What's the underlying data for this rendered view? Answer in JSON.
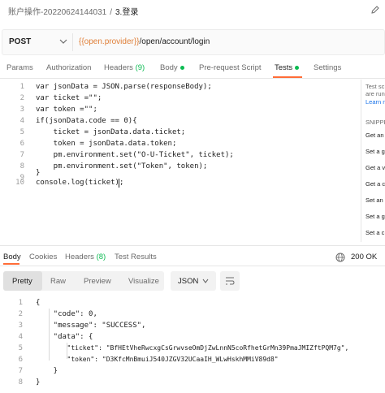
{
  "breadcrumb": {
    "parent": "账户操作-20220624144031",
    "separator": "/",
    "current": "3.登录"
  },
  "request": {
    "method": "POST",
    "url_variable": "{{open.provider}}",
    "url_path": "/open/account/login"
  },
  "request_tabs": {
    "params": "Params",
    "authorization": "Authorization",
    "headers": "Headers",
    "headers_count": "(9)",
    "body": "Body",
    "pre_request": "Pre-request Script",
    "tests": "Tests",
    "settings": "Settings"
  },
  "editor": {
    "line_numbers": [
      "1",
      "2",
      "3",
      "4",
      "5",
      "6",
      "7",
      "8",
      "9",
      "10"
    ],
    "lines": [
      "var jsonData = JSON.parse(responseBody);",
      "var ticket =\"\";",
      "var token =\"\";",
      "if(jsonData.code == 0){",
      "    ticket = jsonData.data.ticket;",
      "    token = jsonData.data.token;",
      "    pm.environment.set(\"O-U-Ticket\", ticket);",
      "    pm.environment.set(\"Token\", token);",
      "}",
      "console.log(ticket);"
    ]
  },
  "snippets_panel": {
    "intro_line1": "Test sc",
    "intro_line2": "are run",
    "learn_more": "Learn m",
    "heading": "SNIPPE",
    "items": [
      "Get an",
      "Set a g",
      "Get a v",
      "Get a c",
      "Set an",
      "Set a g",
      "Set a c"
    ]
  },
  "response_tabs": {
    "body": "Body",
    "cookies": "Cookies",
    "headers": "Headers",
    "headers_count": "(8)",
    "test_results": "Test Results"
  },
  "status": {
    "text": "200 OK",
    "color": "#0cbb52"
  },
  "view_modes": {
    "pretty": "Pretty",
    "raw": "Raw",
    "preview": "Preview",
    "visualize": "Visualize"
  },
  "format": "JSON",
  "response": {
    "line_numbers": [
      "1",
      "2",
      "3",
      "4",
      "5",
      "6",
      "7",
      "8"
    ],
    "lines": [
      "{",
      "    \"code\": 0,",
      "    \"message\": \"SUCCESS\",",
      "    \"data\": {",
      "        \"ticket\": \"BfHEtVheRwcxgCsGrwvseOmDjZwLnnN5coRfhetGrMn39PmaJMIZftPQM7g\",",
      "        \"token\": \"D3KfcMnBmuiJ540JZGV32UCaaIH_WLwHskhMMiV89d8\"",
      "    }",
      "}"
    ]
  },
  "accent_color": "#ff6c37"
}
